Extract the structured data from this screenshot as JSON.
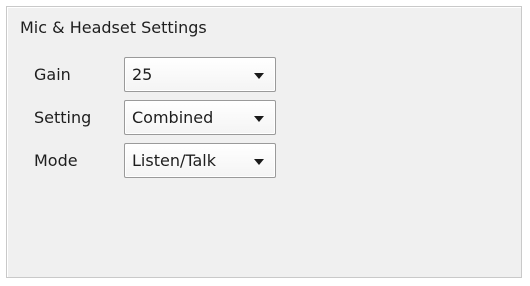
{
  "panel": {
    "title": "Mic & Headset Settings"
  },
  "rows": [
    {
      "label": "Gain",
      "value": "25",
      "arrow_icon": "chevron-down-icon"
    },
    {
      "label": "Setting",
      "value": "Combined",
      "arrow_icon": "chevron-down-icon"
    },
    {
      "label": "Mode",
      "value": "Listen/Talk",
      "arrow_icon": "chevron-down-icon"
    }
  ]
}
